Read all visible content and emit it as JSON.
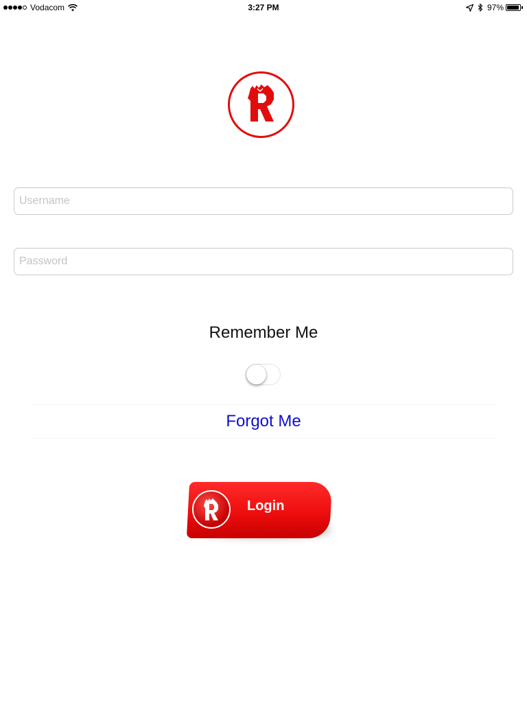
{
  "status_bar": {
    "carrier": "Vodacom",
    "time": "3:27 PM",
    "battery_percent": "97%",
    "battery_level": 0.97,
    "signal_bars": 4,
    "signal_max": 5,
    "icons": [
      "wifi-icon",
      "location-arrow-icon",
      "bluetooth-icon",
      "battery-icon"
    ]
  },
  "logo": {
    "icon": "r-logo-icon",
    "color": "#e10d0d"
  },
  "form": {
    "username_placeholder": "Username",
    "username_value": "",
    "password_placeholder": "Password",
    "password_value": ""
  },
  "remember": {
    "label": "Remember Me",
    "enabled": false
  },
  "forgot": {
    "label": "Forgot Me",
    "color": "#0f0fce"
  },
  "login": {
    "label": "Login",
    "color": "#ee0e0e",
    "icon": "r-logo-icon"
  }
}
